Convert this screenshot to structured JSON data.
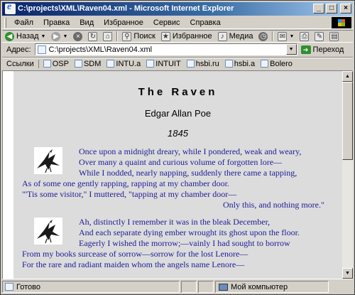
{
  "window": {
    "title": "C:\\projects\\XML\\Raven04.xml - Microsoft Internet Explorer",
    "min_glyph": "_",
    "max_glyph": "□",
    "close_glyph": "×"
  },
  "menu": [
    "Файл",
    "Правка",
    "Вид",
    "Избранное",
    "Сервис",
    "Справка"
  ],
  "toolbar": {
    "back": "Назад",
    "search": "Поиск",
    "favorites": "Избранное",
    "media": "Медиа"
  },
  "address": {
    "label": "Адрес:",
    "value": "C:\\projects\\XML\\Raven04.xml",
    "go": "Переход"
  },
  "links": {
    "label": "Ссылки",
    "items": [
      "OSP",
      "SDM",
      "INTU.a",
      "INTUIT",
      "hsbi.ru",
      "hsbi.a",
      "Bolero"
    ]
  },
  "poem": {
    "title": "The Raven",
    "author": "Edgar Allan Poe",
    "year": "1845",
    "stanza1": [
      "Once upon a midnight dreary, while I pondered, weak and weary,",
      "Over many a quaint and curious volume of forgotten lore—",
      "While I nodded, nearly napping, suddenly there came a tapping,",
      "As of some one gently rapping, rapping at my chamber door.",
      "\"'Tis some visitor,\" I muttered, \"tapping at my chamber door—",
      "Only this, and nothing more.\""
    ],
    "stanza2": [
      "Ah, distinctly I remember it was in the bleak December,",
      "And each separate dying ember wrought its ghost upon the floor.",
      "Eagerly I wished the morrow;—vainly I had sought to borrow",
      "From my books surcease of sorrow—sorrow for the lost Lenore—",
      "For the rare and radiant maiden whom the angels name Lenore—"
    ]
  },
  "status": {
    "left": "Готово",
    "zone": "Мой компьютер"
  },
  "icons": {
    "app": "ie-icon",
    "raven": "raven-icon",
    "page": "page-icon"
  }
}
